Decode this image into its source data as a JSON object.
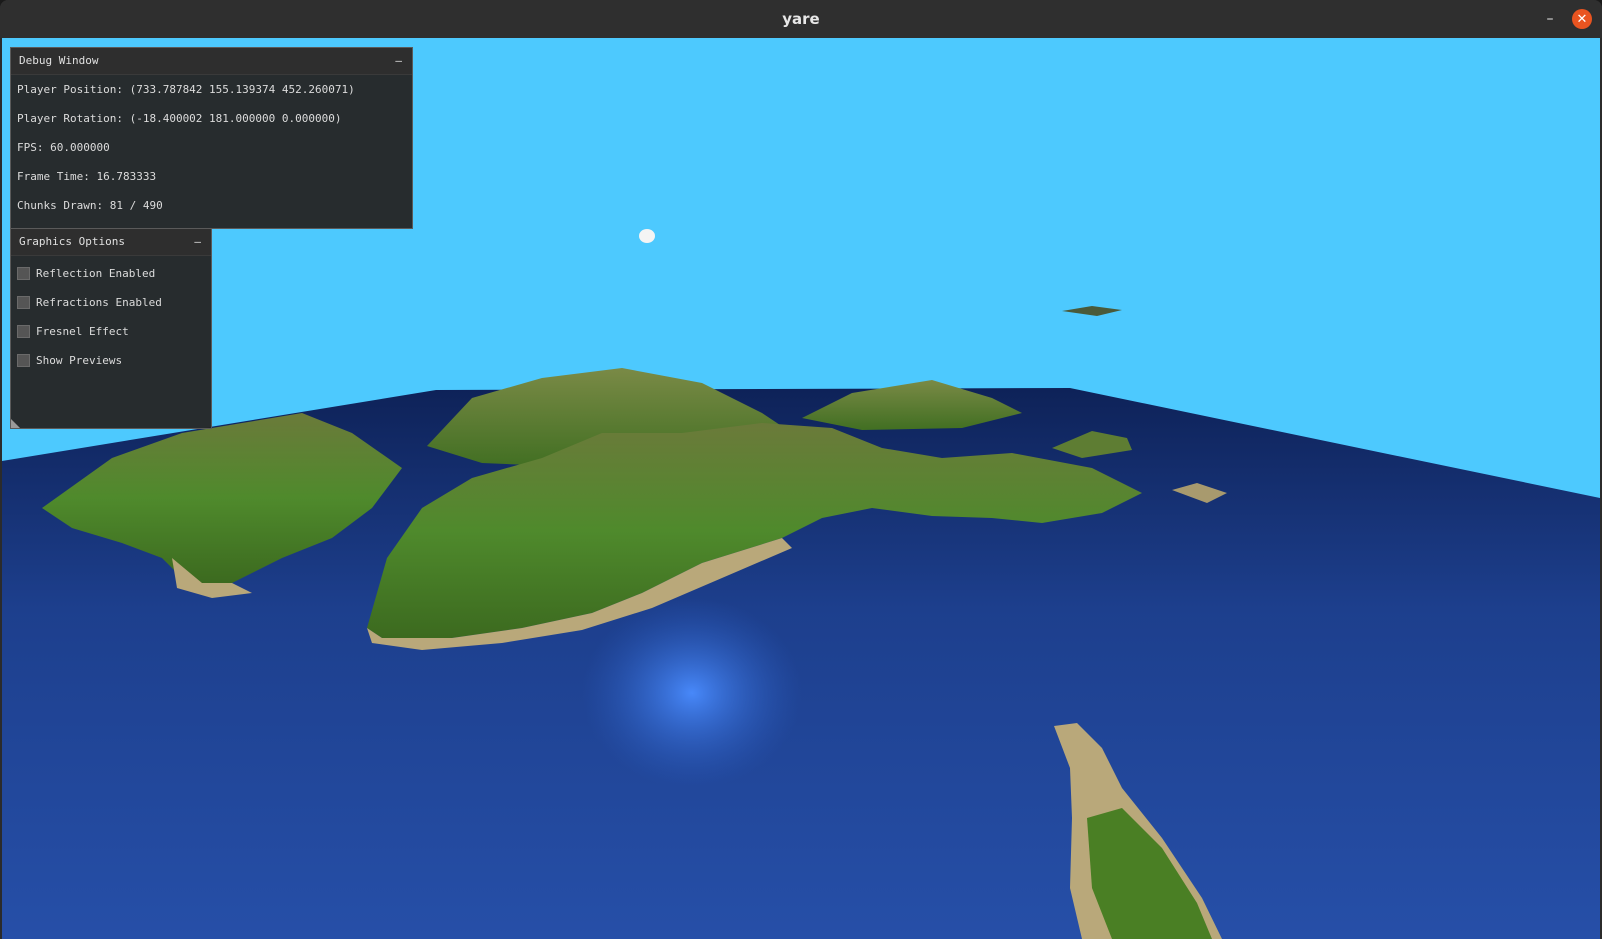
{
  "window": {
    "title": "yare"
  },
  "debug_window": {
    "title": "Debug Window",
    "collapse": "–",
    "rows": [
      "Player Position: (733.787842 155.139374 452.260071)",
      "Player Rotation: (-18.400002 181.000000 0.000000)",
      "FPS: 60.000000",
      "Frame Time: 16.783333",
      "Chunks Drawn: 81 / 490"
    ]
  },
  "graphics_options": {
    "title": "Graphics Options",
    "collapse": "–",
    "options": [
      {
        "label": "Reflection Enabled",
        "checked": false
      },
      {
        "label": "Refractions Enabled",
        "checked": false
      },
      {
        "label": "Fresnel Effect",
        "checked": false
      },
      {
        "label": "Show Previews",
        "checked": false
      }
    ]
  },
  "scene": {
    "sky_color": "#4dc9fe",
    "water_color": "#1e4390",
    "grass_color": "#4f8a2c",
    "sand_color": "#b9a87a"
  },
  "icons": {
    "close": "close-icon",
    "minimize": "minimize-icon"
  }
}
